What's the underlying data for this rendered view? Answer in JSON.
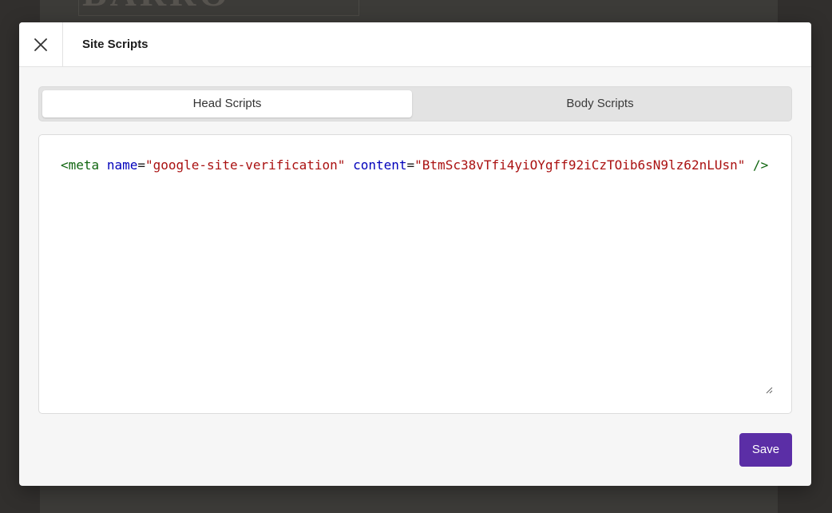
{
  "background": {
    "logo_text": "BARRO"
  },
  "modal": {
    "title": "Site Scripts",
    "close_icon": "close-icon"
  },
  "tabs": [
    {
      "label": "Head Scripts",
      "active": true
    },
    {
      "label": "Body Scripts",
      "active": false
    }
  ],
  "editor": {
    "language": "html",
    "value": "<meta name=\"google-site-verification\" content=\"BtmSc38vTfi4yiOYgff92iCzTOib6sN9lz62nLUsn\" />",
    "tokens": {
      "tag_open": "<meta",
      "attr1_name": "name",
      "eq1": "=",
      "attr1_value": "\"google-site-verification\"",
      "attr2_name": "content",
      "eq2": "=",
      "attr2_value": "\"BtmSc38vTfi4yiOYgff92iCzTOib6sN9lz62nLUsn\"",
      "tag_close": "/>"
    }
  },
  "actions": {
    "save_label": "Save"
  },
  "colors": {
    "accent": "#5b2ea6",
    "tag": "#116611",
    "attribute": "#0000bb",
    "string": "#aa1111"
  }
}
